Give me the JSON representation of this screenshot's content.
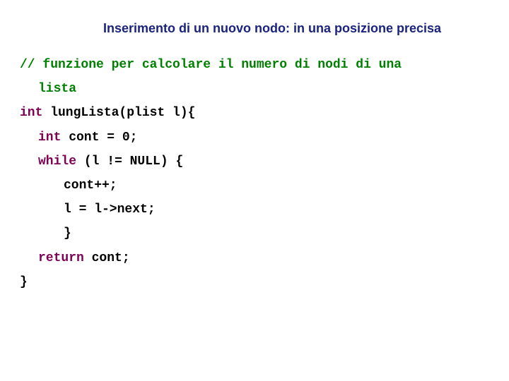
{
  "title": "Inserimento di un nuovo nodo: in una posizione precisa",
  "code": {
    "c1a": "// funzione per calcolare il numero di nodi di una",
    "c1b": "lista",
    "l2_kw": "int",
    "l2_rest": " lungLista(plist l){",
    "l3_kw": "int",
    "l3_rest": " cont = 0;",
    "l4_kw": "while",
    "l4_rest": " (l != NULL) {",
    "l5": "cont++;",
    "l6": "l = l->next;",
    "l7": "}",
    "l8_kw": "return",
    "l8_rest": " cont;",
    "l9": "}"
  }
}
